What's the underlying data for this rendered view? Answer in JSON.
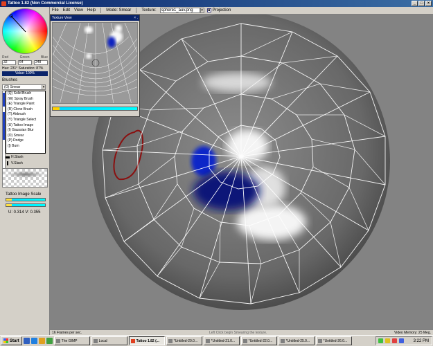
{
  "window": {
    "title": "Tattoo 1.82 (Non Commercial License)",
    "min": "_",
    "max": "□",
    "close": "×"
  },
  "menu": {
    "file": "File",
    "edit": "Edit",
    "view": "View",
    "help": "Help"
  },
  "mode": {
    "label": "Mode: Smear"
  },
  "texture": {
    "label": "Texture:",
    "value": "sphere1_auv.png"
  },
  "projection": {
    "label": "Projection",
    "checked": true
  },
  "color": {
    "labels": {
      "red": "Red",
      "green": "Green",
      "blue": "Blue"
    },
    "red": "32",
    "green": "64",
    "blue": "248",
    "hue_sat": "Hue: 231°  Saturation: 87%",
    "value": "Value: 100%"
  },
  "brushes": {
    "label": "Brushes",
    "selected": "(O) Smear",
    "items": [
      "(Q) Solid Brush",
      "(W) Spray Brush",
      "(E) Triangle Paint",
      "(R) Clone Brush",
      "(T) Airbrush",
      "(Y) Triangle Select",
      "(U) Tattoo Image",
      "(I) Gaussian Blur",
      "(O) Smear",
      "(P) Dodge",
      "([) Burn"
    ],
    "h_slash": "H.Slash",
    "v_slash": "V.Slash"
  },
  "scale": {
    "label": "Tattoo Image Scale",
    "uv": "U: 0.314  V: 0.355"
  },
  "texture_view": {
    "title": "Texture View",
    "close": "× ."
  },
  "status": {
    "fps": "16 Frames per sec.",
    "hint": "Left Click begin Smearing the texture.",
    "vram": "Video Memory: 25 Meg."
  },
  "taskbar": {
    "start": "Start",
    "tasks": [
      "The GIMP",
      "Local",
      "Tattoo 1.82 (...",
      "*Untitled-20.0...",
      "*Untitled-21.0...",
      "*Untitled-22.0...",
      "*Untitled-25.0...",
      "*Untitled-26.0..."
    ],
    "active_index": 2,
    "clock": "3:22 PM"
  }
}
